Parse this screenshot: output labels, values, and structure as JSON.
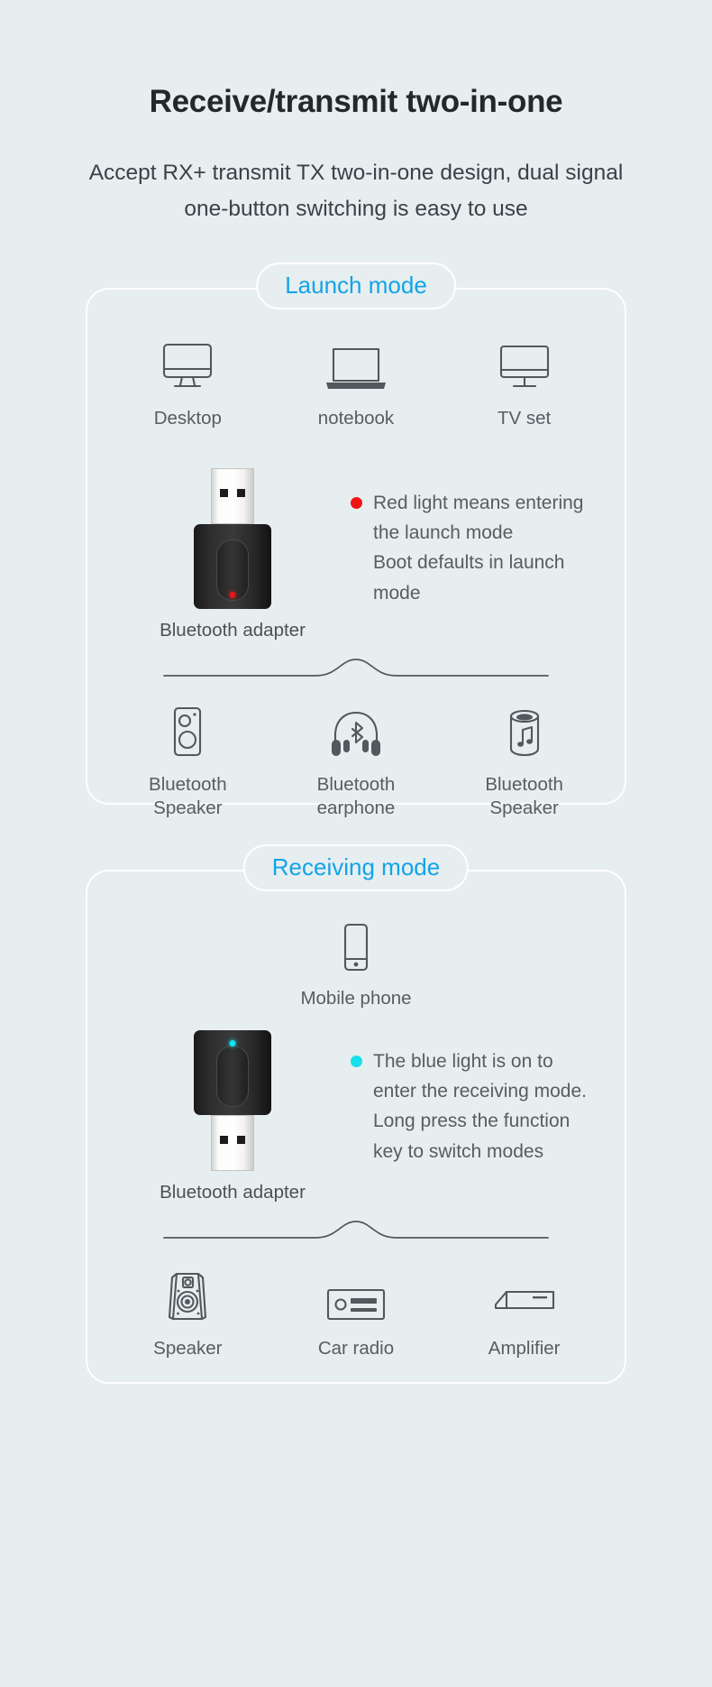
{
  "header": {
    "title": "Receive/transmit two-in-one",
    "subtitle_line1": "Accept RX+ transmit TX two-in-one design, dual signal",
    "subtitle_line2": "one-button switching is easy to use"
  },
  "colors": {
    "background": "#e6eef0",
    "badge_text": "#14a3e8",
    "icon_stroke": "#53585c",
    "body_text": "#575d61",
    "red_led": "#f01414",
    "blue_led": "#17e0ec"
  },
  "launch_section": {
    "badge": "Launch mode",
    "sources": [
      {
        "label": "Desktop",
        "icon": "desktop-monitor-icon"
      },
      {
        "label": "notebook",
        "icon": "laptop-icon"
      },
      {
        "label": "TV set",
        "icon": "tv-icon"
      }
    ],
    "adapter": {
      "caption": "Bluetooth adapter",
      "led_color": "red",
      "orientation": "usb-up"
    },
    "notes": [
      {
        "bullet": "red",
        "text": "Red light means entering"
      },
      {
        "bullet": "none",
        "text": "the launch mode"
      },
      {
        "bullet": "none",
        "text": "Boot defaults in launch"
      },
      {
        "bullet": "none",
        "text": "mode"
      }
    ],
    "outputs": [
      {
        "label_line1": "Bluetooth",
        "label_line2": "Speaker",
        "icon": "bluetooth-box-speaker-icon"
      },
      {
        "label_line1": "Bluetooth",
        "label_line2": "earphone",
        "icon": "bluetooth-headphone-icon"
      },
      {
        "label_line1": "Bluetooth",
        "label_line2": "Speaker",
        "icon": "bluetooth-cylinder-speaker-icon"
      }
    ]
  },
  "receive_section": {
    "badge": "Receiving mode",
    "sources": [
      {
        "label": "Mobile phone",
        "icon": "mobile-phone-icon"
      }
    ],
    "adapter": {
      "caption": "Bluetooth adapter",
      "led_color": "blue",
      "orientation": "usb-down"
    },
    "notes": [
      {
        "bullet": "blue",
        "text": "The blue light is on to"
      },
      {
        "bullet": "none",
        "text": "enter the receiving mode."
      },
      {
        "bullet": "none",
        "text": "Long press the function"
      },
      {
        "bullet": "none",
        "text": "key to switch modes"
      }
    ],
    "outputs": [
      {
        "label_line1": "Speaker",
        "label_line2": "",
        "icon": "studio-speaker-icon"
      },
      {
        "label_line1": "Car radio",
        "label_line2": "",
        "icon": "car-radio-icon"
      },
      {
        "label_line1": "Amplifier",
        "label_line2": "",
        "icon": "amplifier-icon"
      }
    ]
  }
}
